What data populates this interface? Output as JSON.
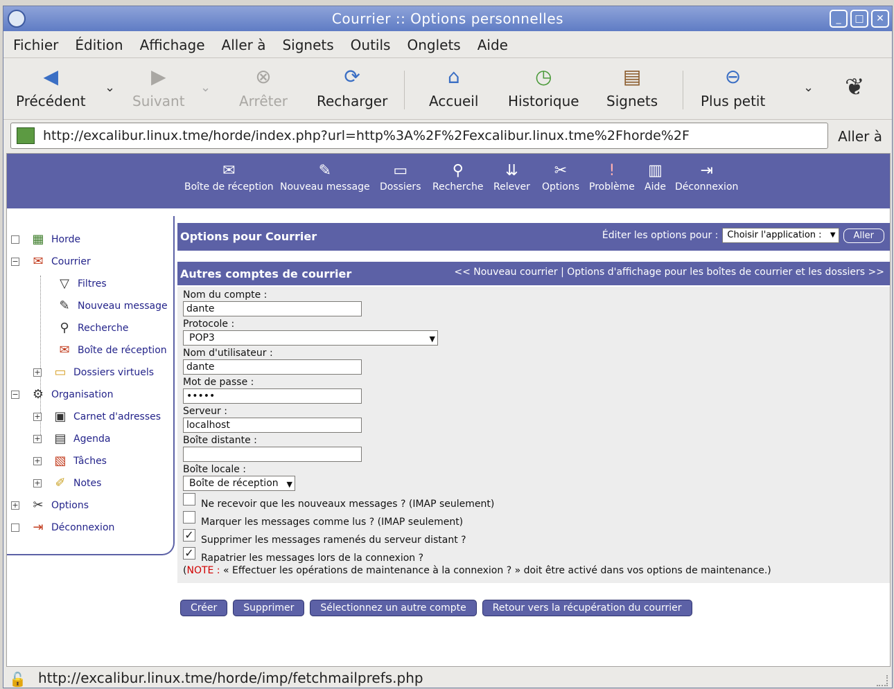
{
  "window": {
    "title": "Courrier :: Options personnelles"
  },
  "menu": [
    "Fichier",
    "Édition",
    "Affichage",
    "Aller à",
    "Signets",
    "Outils",
    "Onglets",
    "Aide"
  ],
  "toolbar": {
    "back": "Précédent",
    "forward": "Suivant",
    "stop": "Arrêter",
    "reload": "Recharger",
    "home": "Accueil",
    "history": "Historique",
    "bookmarks": "Signets",
    "zoom_out": "Plus petit"
  },
  "location": {
    "url": "http://excalibur.linux.tme/horde/index.php?url=http%3A%2F%2Fexcalibur.linux.tme%2Fhorde%2F",
    "go_label": "Aller à"
  },
  "horde_nav": [
    "Boîte de réception",
    "Nouveau message",
    "Dossiers",
    "Recherche",
    "Relever",
    "Options",
    "Problème",
    "Aide",
    "Déconnexion"
  ],
  "sidebar": {
    "horde": "Horde",
    "courrier": "Courrier",
    "filtres": "Filtres",
    "nouveau_message": "Nouveau message",
    "recherche": "Recherche",
    "boite_reception": "Boîte de réception",
    "dossiers_virtuels": "Dossiers virtuels",
    "organisation": "Organisation",
    "carnet": "Carnet d'adresses",
    "agenda": "Agenda",
    "taches": "Tâches",
    "notes": "Notes",
    "options": "Options",
    "deconnexion": "Déconnexion"
  },
  "pane": {
    "title": "Options pour Courrier",
    "edit_label": "Éditer les options pour :",
    "app_select": "Choisir l'application :",
    "aller": "Aller",
    "section_title": "Autres comptes de courrier",
    "section_links": "<< Nouveau courrier | Options d'affichage pour les boîtes de courrier et les dossiers >>"
  },
  "form": {
    "account_label": "Nom du compte :",
    "account_value": "dante",
    "protocol_label": "Protocole :",
    "protocol_value": "POP3",
    "username_label": "Nom d'utilisateur :",
    "username_value": "dante",
    "password_label": "Mot de passe :",
    "password_value": "•••••",
    "server_label": "Serveur :",
    "server_value": "localhost",
    "remote_box_label": "Boîte distante :",
    "remote_box_value": "",
    "local_box_label": "Boîte locale :",
    "local_box_value": "Boîte de réception",
    "cb1": "Ne recevoir que les nouveaux messages ? (IMAP seulement)",
    "cb2": "Marquer les messages comme lus ? (IMAP seulement)",
    "cb3": "Supprimer les messages ramenés du serveur distant ?",
    "cb4": "Rapatrier les messages lors de la connexion ?",
    "note_open": "(",
    "note_tag": "NOTE :",
    "note_rest": " « Effectuer les opérations de maintenance à la connexion ? » doit être activé dans vos options de maintenance.)"
  },
  "buttons": {
    "create": "Créer",
    "delete": "Supprimer",
    "select_other": "Sélectionnez un autre compte",
    "back_fetch": "Retour vers la récupération du courrier"
  },
  "status": {
    "url": "http://excalibur.linux.tme/horde/imp/fetchmailprefs.php"
  }
}
